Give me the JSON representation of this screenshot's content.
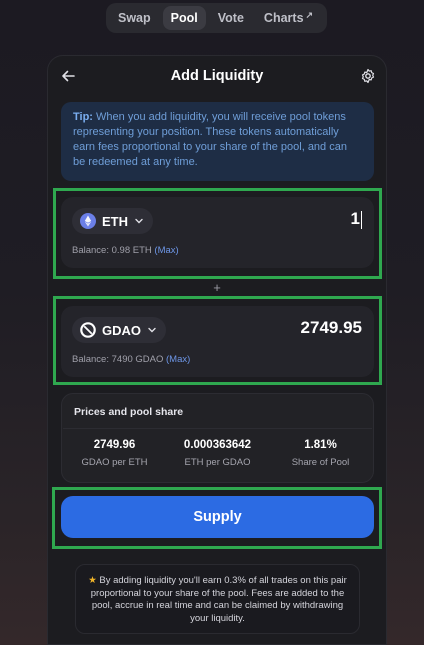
{
  "nav": {
    "items": [
      {
        "label": "Swap",
        "active": false
      },
      {
        "label": "Pool",
        "active": true
      },
      {
        "label": "Vote",
        "active": false
      },
      {
        "label": "Charts",
        "active": false,
        "external_glyph": "↗"
      }
    ]
  },
  "header": {
    "title": "Add Liquidity",
    "back_icon": "arrow-left-icon",
    "settings_icon": "gear-icon"
  },
  "tip": {
    "prefix": "Tip:",
    "text": "When you add liquidity, you will receive pool tokens representing your position. These tokens automatically earn fees proportional to your share of the pool, and can be redeemed at any time."
  },
  "token_a": {
    "symbol": "ETH",
    "icon": "ethereum-icon",
    "amount": "1",
    "balance_label": "Balance:",
    "balance_value": "0.98 ETH",
    "max_label": "(Max)"
  },
  "separator": "+",
  "token_b": {
    "symbol": "GDAO",
    "icon": "gdao-icon",
    "amount": "2749.95",
    "balance_label": "Balance:",
    "balance_value": "7490 GDAO",
    "max_label": "(Max)"
  },
  "prices": {
    "title": "Prices and pool share",
    "stats": [
      {
        "value": "2749.96",
        "label": "GDAO per ETH"
      },
      {
        "value": "0.000363642",
        "label": "ETH per GDAO"
      },
      {
        "value": "1.81%",
        "label": "Share of Pool"
      }
    ]
  },
  "supply_button": {
    "label": "Supply"
  },
  "note": {
    "star": "★",
    "text": "By adding liquidity you'll earn 0.3% of all trades on this pair proportional to your share of the pool. Fees are added to the pool, accrue in real time and can be claimed by withdrawing your liquidity."
  },
  "colors": {
    "accent": "#2c6be3",
    "highlight": "#2fa84f",
    "tip_bg": "#1e2d45",
    "tip_text": "#6f9ed8",
    "max_link": "#6e97e8"
  }
}
